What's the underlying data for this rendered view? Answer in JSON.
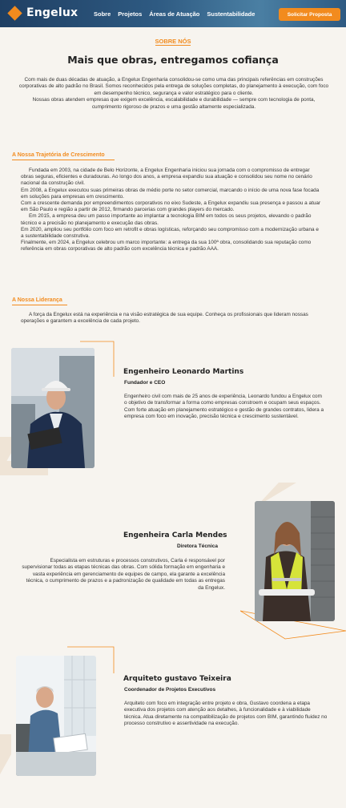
{
  "header": {
    "brand": "Engelux",
    "nav": [
      "Sobre",
      "Projetos",
      "Áreas de Atuação",
      "Sustentabilidade"
    ],
    "cta_label": "Solicitar Proposta",
    "accent": "#f28b1e",
    "brand_color": "#1f3f63"
  },
  "intro": {
    "eyebrow": "SOBRE NÓS",
    "title": "Mais que obras, entregamos cofiança",
    "text": "Com mais de duas décadas de atuação, a Engelux Engenharia consolidou-se como uma das principais referências em construções corporativas de alto padrão no Brasil. Somos reconhecidos pela entrega de soluções completas, do planejamento à execução, com foco em desempenho técnico, segurança e valor estratégico para o cliente.\nNossas obras atendem empresas que exigem excelência, escalabilidade e durabilidade — sempre com tecnologia de ponta, cumprimento rigoroso de prazos e uma gestão altamente especializada."
  },
  "history": {
    "heading": "A Nossa Trajetória de Crescimento",
    "paragraphs": [
      "Fundada em 2003, na cidade de Belo Horizonte, a Engelux Engenharia iniciou sua jornada com o compromisso de entregar obras seguras, eficientes e duradouras. Ao longo dos anos, a empresa expandiu sua atuação e consolidou seu nome no cenário nacional da construção civil.",
      "Em 2008, a Engelux executou suas primeiras obras de médio porte no setor comercial, marcando o início de uma nova fase focada em soluções para empresas em crescimento.",
      "Com a crescente demanda por empreendimentos corporativos no eixo Sudeste, a Engelux expandiu sua presença e passou a atuar em São Paulo e região a partir de 2012, firmando parcerias com grandes players do mercado.",
      "Em 2015, a empresa deu um passo importante ao implantar a tecnologia BIM em todos os seus projetos, elevando o padrão técnico e a precisão no planejamento e execução das obras.",
      "Em 2020, ampliou seu portfólio com foco em retrofit e obras logísticas, reforçando seu compromisso com a modernização urbana e a sustentabilidade construtiva.",
      "Finalmente, em 2024, a Engelux celebrou um marco importante: a entrega da sua 100ª obra, consolidando sua reputação como referência em obras corporativas de alto padrão com excelência técnica e padrão AAA."
    ]
  },
  "leadership": {
    "heading": "A Nossa Liderança",
    "intro": "A força da Engelux está na experiência e na visão estratégica de sua equipe. Conheça os profissionais que lideram nossas operações e garantem a excelência de cada projeto.",
    "people": [
      {
        "name": "Engenheiro Leonardo Martins",
        "role": "Fundador e CEO",
        "bio": "Engenheiro civil com mais de 25 anos de experiência, Leonardo fundou a Engelux com o objetivo de transformar a forma como empresas constroem e ocupam seus espaços. Com forte atuação em planejamento estratégico e gestão de grandes contratos, lidera a empresa com foco em inovação, precisão técnica e crescimento sustentável."
      },
      {
        "name": "Engenheira Carla Mendes",
        "role": "Diretora Técnica",
        "bio": "Especialista em estruturas e processos construtivos, Carla é responsável por supervisionar todas as etapas técnicas das obras. Com sólida formação em engenharia e vasta experiência em gerenciamento de equipes de campo, ela garante a excelência técnica, o cumprimento de prazos e a padronização de qualidade em todas as entregas da Engelux."
      },
      {
        "name": "Arquiteto gustavo Teixeira",
        "role": "Coordenador de Projetos Executivos",
        "bio": "Arquiteto com foco em integração entre projeto e obra, Gustavo coordena a etapa executiva dos projetos com atenção aos detalhes, à funcionalidade e à viabilidade técnica. Atua diretamente na compatibilização de projetos com BIM, garantindo fluidez no processo construtivo e assertividade na execução."
      }
    ]
  }
}
